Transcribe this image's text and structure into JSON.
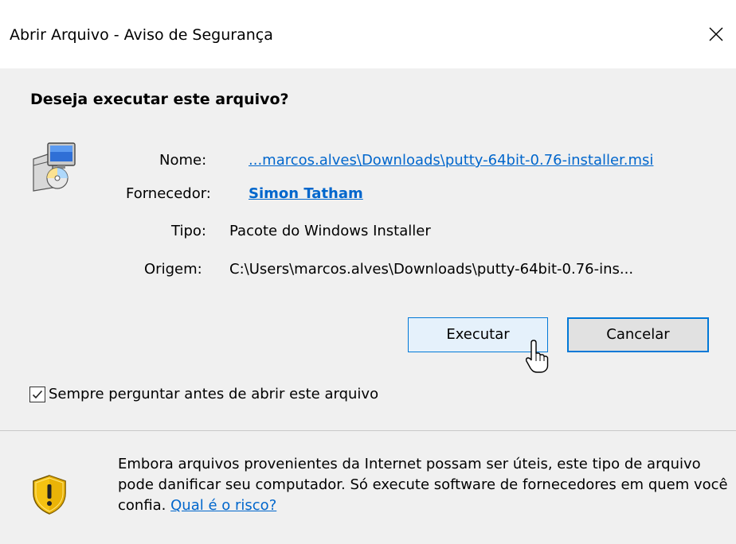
{
  "window": {
    "title": "Abrir Arquivo - Aviso de Segurança",
    "close_glyph": "✕"
  },
  "question": "Deseja executar este arquivo?",
  "file_info": {
    "name_label": "Nome:",
    "name_value": "...marcos.alves\\Downloads\\putty-64bit-0.76-installer.msi",
    "publisher_label": "Fornecedor:",
    "publisher_value": "Simon Tatham",
    "type_label": "Tipo:",
    "type_value": "Pacote do Windows Installer",
    "origin_label": "Origem:",
    "origin_value": "C:\\Users\\marcos.alves\\Downloads\\putty-64bit-0.76-ins..."
  },
  "buttons": {
    "run_label": "Executar",
    "cancel_label": "Cancelar"
  },
  "checkbox": {
    "label": "Sempre perguntar antes de abrir este arquivo",
    "checked": true
  },
  "warning": {
    "text": "Embora arquivos provenientes da Internet possam ser úteis, este tipo de arquivo pode danificar seu computador. Só execute software de fornecedores em quem você confia. ",
    "link_label": "Qual é o risco?"
  },
  "icons": {
    "file": "windows-installer-icon",
    "warning": "security-shield-icon",
    "cursor": "mouse-pointer-icon"
  },
  "colors": {
    "link": "#0066cc",
    "default_button_border": "#0078d7",
    "default_button_bg": "#e5f1fb",
    "dialog_bg": "#f0f0f0",
    "shield_yellow": "#f5c211"
  }
}
